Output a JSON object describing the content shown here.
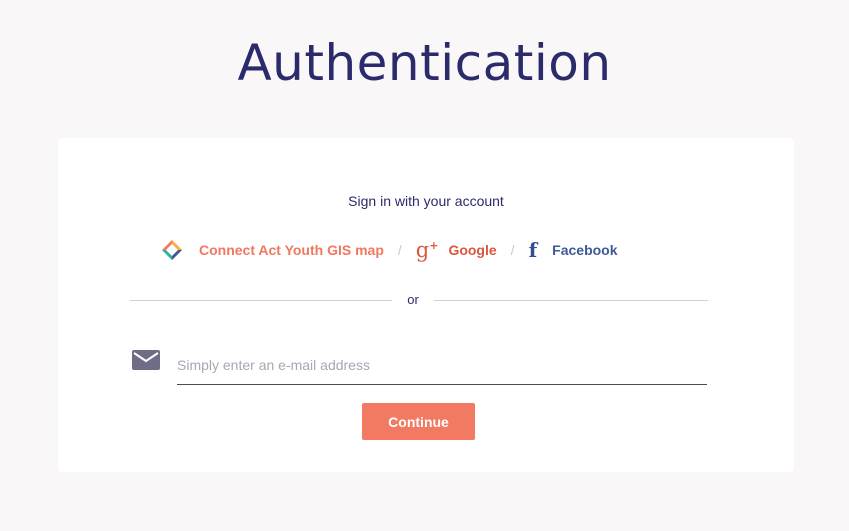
{
  "page": {
    "title": "Authentication"
  },
  "card": {
    "subtitle": "Sign in with your account",
    "providers": [
      {
        "label": "Connect Act Youth GIS map",
        "icon": "connect-act-youth-logo-icon",
        "color": "#f0785f"
      },
      {
        "label": "Google",
        "icon": "google-plus-icon",
        "glyph": "g",
        "color": "#d9573c"
      },
      {
        "label": "Facebook",
        "icon": "facebook-icon",
        "glyph": "f",
        "color": "#3d5a96"
      }
    ],
    "separator": "/",
    "divider_text": "or",
    "email": {
      "placeholder": "Simply enter an e-mail address",
      "value": "",
      "icon": "envelope-icon"
    },
    "continue_label": "Continue"
  },
  "colors": {
    "accent": "#f27a63",
    "title": "#2b2a6b",
    "background": "#faf7f8"
  }
}
